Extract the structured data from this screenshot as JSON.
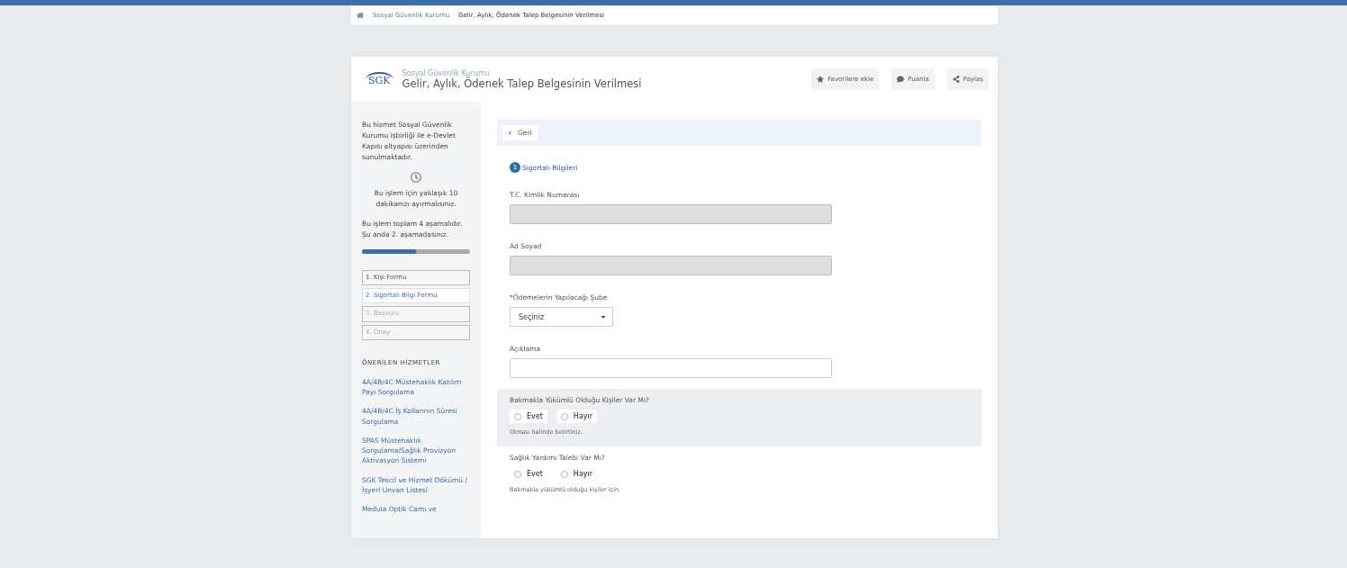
{
  "breadcrumb": {
    "items": [
      "Sosyal Güvenlik Kurumu",
      "Gelir, Aylık, Ödenek Talep Belgesinin Verilmesi"
    ]
  },
  "header": {
    "logo": "SGK",
    "institution": "Sosyal Güvenlik Kurumu",
    "title": "Gelir, Aylık, Ödenek Talep Belgesinin Verilmesi",
    "actions": [
      {
        "label": "Favorilere ekle",
        "kind": "star"
      },
      {
        "label": "Puanla",
        "kind": "comment"
      },
      {
        "label": "Paylaş",
        "kind": "share"
      }
    ]
  },
  "sidebar": {
    "intro": "Bu hizmet Sosyal Güvenlik Kurumu işbirliği ile e-Devlet Kapısı altyapısı üzerinden sunulmaktadır.",
    "duration": "Bu işlem için yaklaşık 10 dakikanızı ayırmalısınız.",
    "progress_text": "Bu işlem toplam 4 aşamalıdır. Şu anda 2. aşamadasınız.",
    "progress": {
      "level": 0.5
    },
    "steps": [
      {
        "label": "1. Kişi Formu",
        "selected": false,
        "disabled": false
      },
      {
        "label": "2. Sigortalı Bilgi Formu",
        "selected": true,
        "disabled": false
      },
      {
        "label": "3. Başvuru",
        "selected": false,
        "disabled": true
      },
      {
        "label": "4. Onay",
        "selected": false,
        "disabled": true
      }
    ],
    "related_title": "ÖNERİLEN HİZMETLER",
    "related": [
      "4A/4B/4C Müstehaklık Katılım Payı Sorgulama",
      "4A/4B/4C İş Kollarının Süresi Sorgulama",
      "SPAS Müstehaklık Sorgulama/Sağlık Provizyon Aktivasyon Sistemi",
      "SGK Tescil ve Hizmet Dökümü / İşyeri Unvan Listesi",
      "Medula Optik Camı ve"
    ]
  },
  "form": {
    "back": "Geri",
    "section_number": "1",
    "section_title": "Sigortalı Bilgileri",
    "fields": [
      {
        "kind": "text",
        "label": "T.C. Kimlik Numarası",
        "disabled": true
      },
      {
        "kind": "text",
        "label": "Ad Soyad",
        "disabled": true
      },
      {
        "kind": "select",
        "label": "*Ödemelerin Yapılacağı Şube",
        "value": "Seçiniz"
      },
      {
        "kind": "text",
        "label": "Açıklama",
        "disabled": false
      },
      {
        "kind": "radio",
        "label": "Bakmakla Yükümlü Olduğu Kişiler Var Mı?",
        "highlighted": true,
        "options": [
          {
            "label": "Evet",
            "selected": false
          },
          {
            "label": "Hayır",
            "selected": false
          }
        ],
        "hint": "Olması halinde belirtiniz."
      },
      {
        "kind": "radio",
        "label": "Sağlık Yardımı Talebi Var Mı?",
        "highlighted": false,
        "options": [
          {
            "label": "Evet",
            "selected": false
          },
          {
            "label": "Hayır",
            "selected": false
          }
        ],
        "hint": "Bakmakla yükümlü olduğu kişiler için."
      }
    ]
  }
}
